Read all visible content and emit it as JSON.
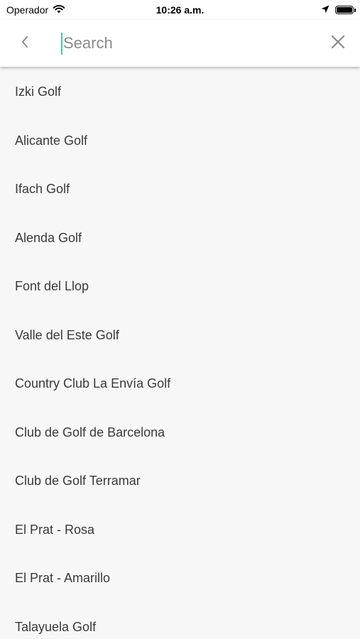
{
  "status_bar": {
    "carrier": "Operador",
    "time": "10:26 a.m."
  },
  "search": {
    "placeholder": "Search",
    "value": ""
  },
  "colors": {
    "caret": "#3ad0a0",
    "background": "#f7f7f7",
    "header": "#ffffff"
  },
  "icons": {
    "back": "chevron-left-icon",
    "clear": "close-icon",
    "wifi": "wifi-icon",
    "location": "location-arrow-icon",
    "battery": "battery-icon"
  },
  "results": [
    {
      "name": "Izki Golf"
    },
    {
      "name": "Alicante Golf"
    },
    {
      "name": "Ifach Golf"
    },
    {
      "name": "Alenda Golf"
    },
    {
      "name": "Font del Llop"
    },
    {
      "name": "Valle del Este Golf"
    },
    {
      "name": "Country Club La Envía Golf"
    },
    {
      "name": "Club de Golf de Barcelona"
    },
    {
      "name": "Club de Golf Terramar"
    },
    {
      "name": "El Prat - Rosa"
    },
    {
      "name": "El Prat - Amarillo"
    },
    {
      "name": "Talayuela Golf"
    }
  ]
}
